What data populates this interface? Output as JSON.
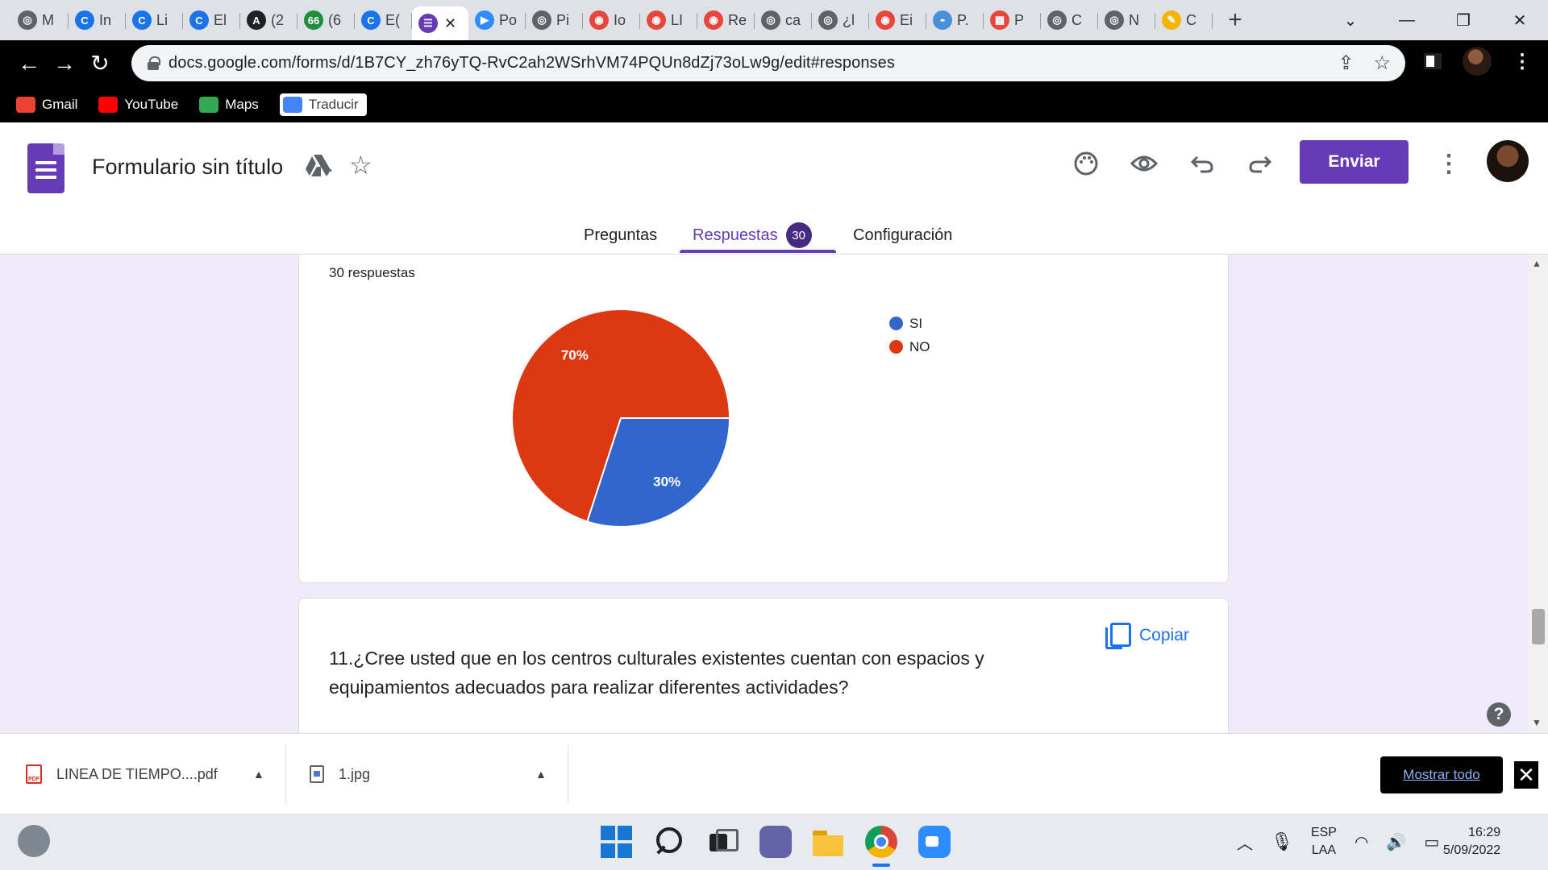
{
  "browser": {
    "tabs": [
      {
        "title": "M",
        "icon": "chrome-icon",
        "color": "#5f6368"
      },
      {
        "title": "In",
        "icon": "c-icon",
        "color": "#1a73e8"
      },
      {
        "title": "Li",
        "icon": "c-icon",
        "color": "#1a73e8"
      },
      {
        "title": "El",
        "icon": "c-icon",
        "color": "#1a73e8"
      },
      {
        "title": "(2",
        "icon": "a-icon",
        "color": "#202124"
      },
      {
        "title": "(6",
        "icon": "badge-icon",
        "color": "#1e8e3e"
      },
      {
        "title": "E(",
        "icon": "c-icon",
        "color": "#1a73e8"
      },
      {
        "title": "",
        "icon": "forms-icon",
        "color": "#673ab7",
        "active": true
      },
      {
        "title": "Po",
        "icon": "zoom-icon",
        "color": "#2d8cff"
      },
      {
        "title": "Pi",
        "icon": "globe-icon",
        "color": "#5f6368"
      },
      {
        "title": "Io",
        "icon": "target-icon",
        "color": "#e8453c"
      },
      {
        "title": "LI",
        "icon": "target-icon",
        "color": "#e8453c"
      },
      {
        "title": "Re",
        "icon": "target-icon",
        "color": "#e8453c"
      },
      {
        "title": "ca",
        "icon": "globe-icon",
        "color": "#5f6368"
      },
      {
        "title": "¿l",
        "icon": "globe-icon",
        "color": "#5f6368"
      },
      {
        "title": "Ei",
        "icon": "target-icon",
        "color": "#e8453c"
      },
      {
        "title": "P.",
        "icon": "docs-icon",
        "color": "#4a90d9"
      },
      {
        "title": "P",
        "icon": "chart-icon",
        "color": "#e8453c"
      },
      {
        "title": "C",
        "icon": "globe-icon",
        "color": "#5f6368"
      },
      {
        "title": "N",
        "icon": "globe-icon",
        "color": "#5f6368"
      },
      {
        "title": "C",
        "icon": "pencil-icon",
        "color": "#f4b400"
      }
    ],
    "new_tab": "+",
    "window_controls": {
      "tab_search": "⌄",
      "minimize": "—",
      "restore": "❐",
      "close": "✕"
    },
    "url": "docs.google.com/forms/d/1B7CY_zh76yTQ-RvC2ah2WSrhVM74PQUn8dZj73oLw9g/edit#responses",
    "bookmarks": [
      {
        "label": "Gmail",
        "color": "#ea4335"
      },
      {
        "label": "YouTube",
        "color": "#ff0000"
      },
      {
        "label": "Maps",
        "color": "#34a853"
      },
      {
        "label": "Traducir",
        "color": "#4285f4"
      }
    ]
  },
  "form": {
    "title": "Formulario sin título",
    "send_label": "Enviar",
    "tabs": {
      "questions": "Preguntas",
      "responses": "Respuestas",
      "responses_count": "30",
      "settings": "Configuración"
    }
  },
  "card1": {
    "response_count": "30 respuestas"
  },
  "card2": {
    "copy_label": "Copiar",
    "question": "11.¿Cree usted que en los centros culturales existentes cuentan con espacios y equipamientos adecuados para realizar diferentes actividades?"
  },
  "chart_data": {
    "type": "pie",
    "categories": [
      "SI",
      "NO"
    ],
    "values": [
      30,
      70
    ],
    "labels": [
      "30%",
      "70%"
    ],
    "colors": [
      "#3366cc",
      "#dc3912"
    ],
    "legend": "right"
  },
  "downloads": {
    "items": [
      {
        "name": "LINEA DE TIEMPO....pdf"
      },
      {
        "name": "1.jpg"
      }
    ],
    "show_all": "Mostrar todo",
    "close": "✕"
  },
  "taskbar": {
    "lang_top": "ESP",
    "lang_bottom": "LAA",
    "time": "16:29",
    "date": "5/09/2022"
  }
}
